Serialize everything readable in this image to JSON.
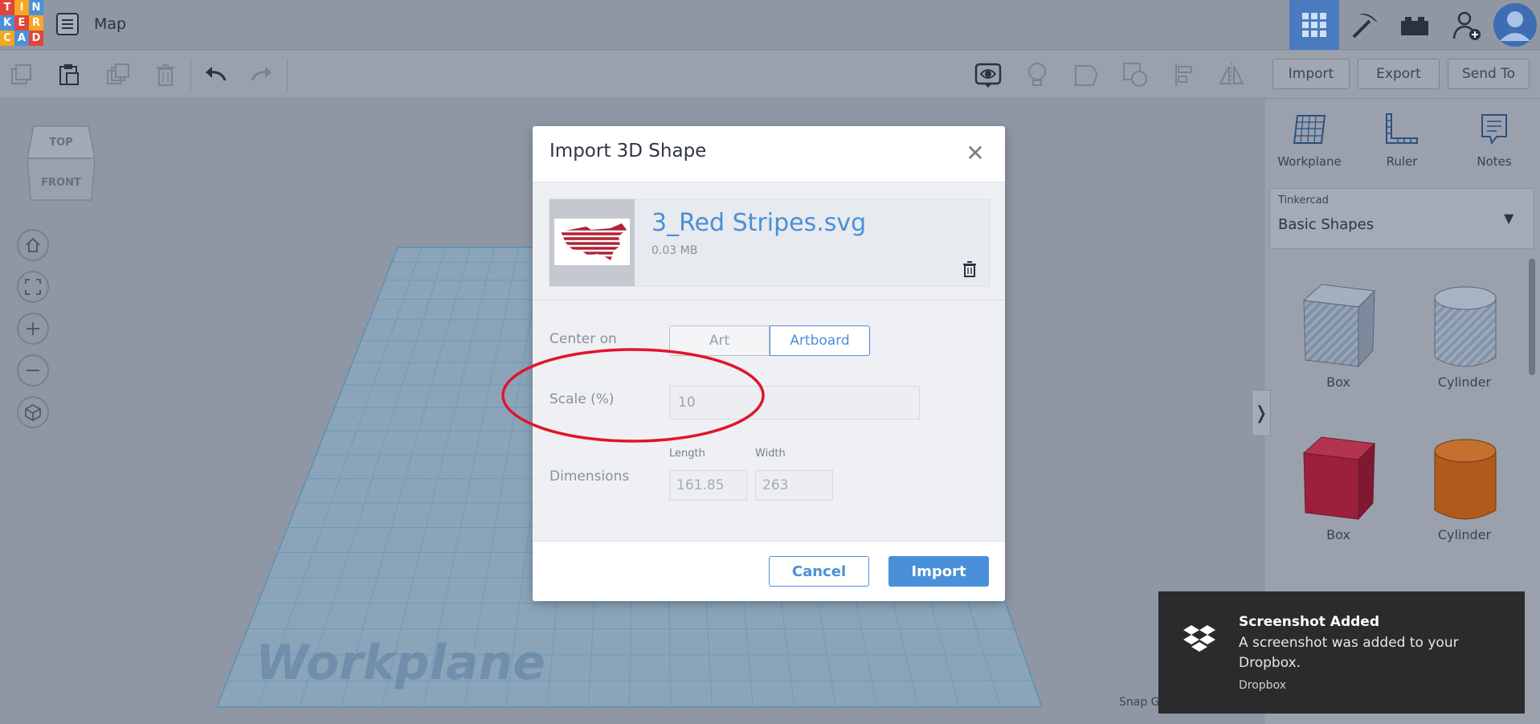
{
  "app": {
    "logo_letters": [
      "T",
      "I",
      "N",
      "K",
      "E",
      "R",
      "C",
      "A",
      "D"
    ],
    "logo_colors": [
      "#e0443b",
      "#f5a623",
      "#4a90d9",
      "#4a90d9",
      "#e0443b",
      "#f5a623",
      "#f5a623",
      "#4a90d9",
      "#e0443b"
    ],
    "document_title": "Map"
  },
  "header": {
    "import_label": "Import",
    "export_label": "Export",
    "send_to_label": "Send To"
  },
  "viewcube": {
    "top": "TOP",
    "front": "FRONT"
  },
  "canvas": {
    "workplane_label": "Workplane",
    "snap_grid_label": "Snap Gr"
  },
  "right_panel": {
    "tools": [
      {
        "label": "Workplane",
        "icon": "workplane-icon"
      },
      {
        "label": "Ruler",
        "icon": "ruler-icon"
      },
      {
        "label": "Notes",
        "icon": "notes-icon"
      }
    ],
    "library": {
      "category": "Tinkercad",
      "name": "Basic Shapes"
    },
    "shapes": [
      {
        "label": "Box",
        "style": "striped"
      },
      {
        "label": "Cylinder",
        "style": "striped"
      },
      {
        "label": "Box",
        "color": "#9c1f3c"
      },
      {
        "label": "Cylinder",
        "color": "#b05a1c"
      }
    ]
  },
  "modal": {
    "title": "Import 3D Shape",
    "file": {
      "name": "3_Red Stripes.svg",
      "size": "0.03 MB"
    },
    "center_on_label": "Center on",
    "center_options": [
      "Art",
      "Artboard"
    ],
    "center_selected": "Artboard",
    "scale_label": "Scale (%)",
    "scale_value": "10",
    "dimensions_label": "Dimensions",
    "length_label": "Length",
    "length_value": "161.85",
    "width_label": "Width",
    "width_value": "263",
    "cancel_label": "Cancel",
    "import_label": "Import"
  },
  "toast": {
    "title": "Screenshot Added",
    "message": "A screenshot was added to your Dropbox.",
    "source": "Dropbox"
  },
  "colors": {
    "accent": "#4a90d9",
    "annotation": "#e0162b",
    "overlay": "#8f97a4"
  }
}
